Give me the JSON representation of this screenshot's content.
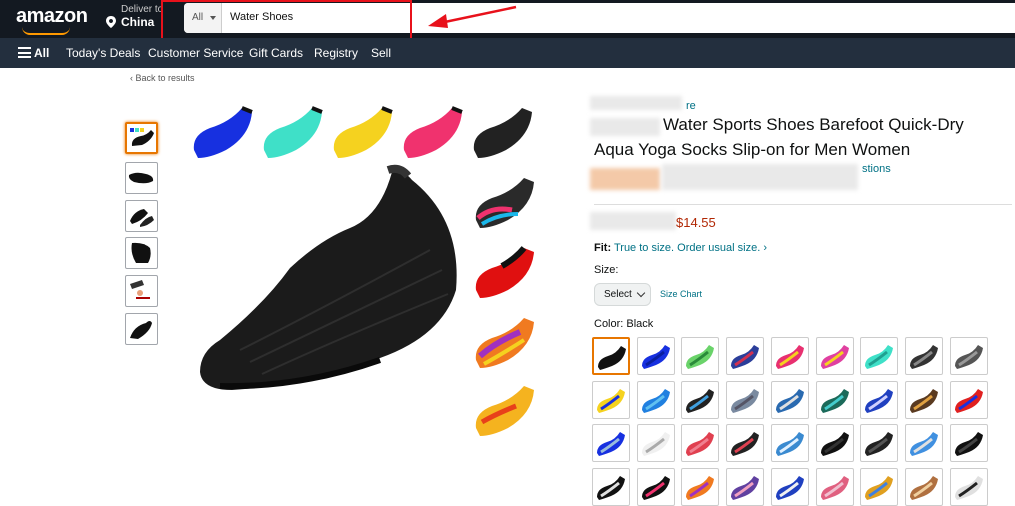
{
  "header": {
    "logo": "amazon",
    "deliver_label": "Deliver to",
    "deliver_location": "China",
    "search_category": "All",
    "search_query": "Water Shoes"
  },
  "nav": {
    "all_label": "All",
    "items": [
      "Today's Deals",
      "Customer Service",
      "Gift Cards",
      "Registry",
      "Sell"
    ]
  },
  "back_link": "‹ Back to results",
  "product": {
    "store_fragment": "re",
    "title_line1": "Water Sports Shoes Barefoot Quick-Dry",
    "title_line2": "Aqua Yoga Socks Slip-on for Men Women",
    "questions_fragment": "stions",
    "price_fragment": "$14.55",
    "fit_label": "Fit:",
    "fit_text": "True to size. Order usual size.",
    "fit_chevron": "›",
    "size_label": "Size:",
    "size_select": "Select",
    "size_chart": "Size Chart",
    "color_label": "Color:",
    "color_value": "Black"
  },
  "colors": {
    "highlight": "#e8111b",
    "header_bg": "#131921",
    "nav_bg": "#232f3e",
    "selected_border": "#e77600",
    "link": "#007185"
  },
  "gallery": {
    "main_shoe_colors": [
      "#1730e0",
      "#3fe0c8",
      "#f5d21f",
      "#f0326e",
      "#222222"
    ],
    "thumbnail_count": 6
  }
}
